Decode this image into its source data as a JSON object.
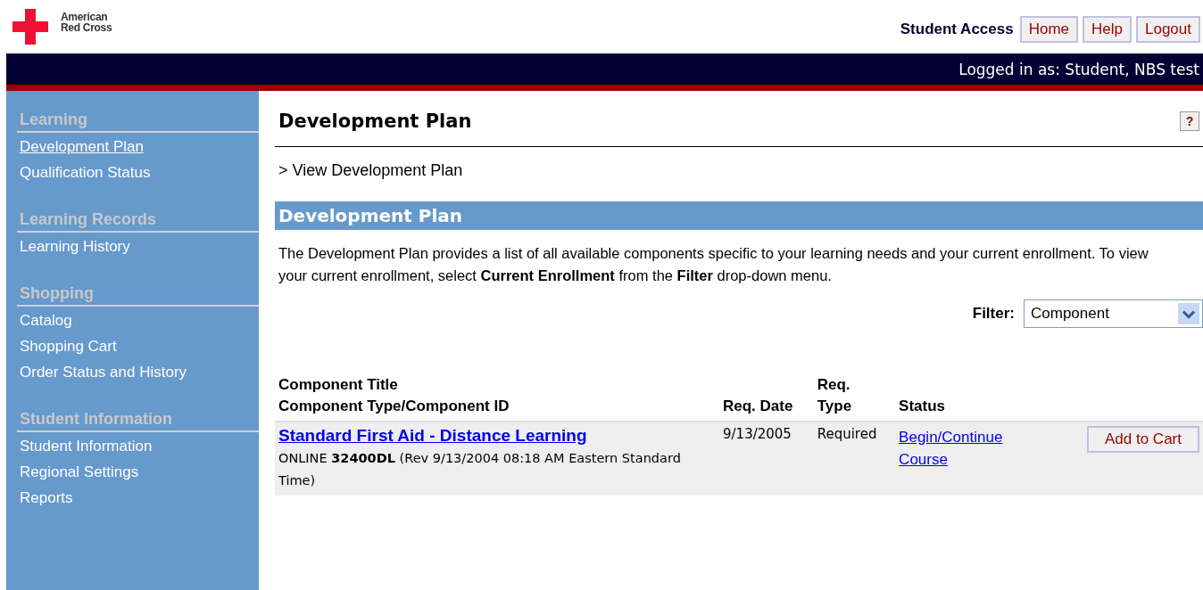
{
  "logo": {
    "line_1": "American",
    "line_2": "Red Cross"
  },
  "header": {
    "title": "Student Access",
    "buttons": [
      "Home",
      "Help",
      "Logout"
    ],
    "logged_in": "Logged in as: Student, NBS test"
  },
  "sidebar": {
    "sections": [
      {
        "heading": "Learning",
        "items": [
          {
            "label": "Development Plan",
            "selected": true
          },
          {
            "label": "Qualification Status",
            "selected": false
          }
        ]
      },
      {
        "heading": "Learning Records",
        "items": [
          {
            "label": "Learning History",
            "selected": false
          }
        ]
      },
      {
        "heading": "Shopping",
        "items": [
          {
            "label": "Catalog",
            "selected": false
          },
          {
            "label": "Shopping Cart",
            "selected": false
          },
          {
            "label": "Order Status and History",
            "selected": false
          }
        ]
      },
      {
        "heading": "Student Information",
        "items": [
          {
            "label": "Student Information",
            "selected": false
          },
          {
            "label": "Regional Settings",
            "selected": false
          },
          {
            "label": "Reports",
            "selected": false
          }
        ]
      }
    ]
  },
  "page": {
    "title": "Development Plan",
    "help_button": "?",
    "breadcrumb": "> View Development Plan",
    "section_title": "Development Plan",
    "description": "The Development Plan provides a list of all available components specific to your learning needs and your current enrollment. To view your current enrollment, select **Current Enrollment** from the **Filter** drop-down menu.",
    "filter": {
      "label": "Filter:",
      "value": "Component"
    }
  },
  "table": {
    "columns": [
      {
        "line_1": "Component Title",
        "line_2": "Component Type/Component ID"
      },
      {
        "line_1": "Req. Date"
      },
      {
        "line_1": "Req.",
        "line_2": "Type"
      },
      {
        "line_1": "Status"
      }
    ],
    "rows": [
      {
        "title": "Standard First Aid - Distance Learning",
        "details": "ONLINE **32400DL** (Rev 9/13/2004 08:18 AM Eastern Standard Time)",
        "req_date": "9/13/2005",
        "req_type": "Required",
        "status": "Begin/Continue Course",
        "action": "Add to Cart"
      }
    ]
  }
}
